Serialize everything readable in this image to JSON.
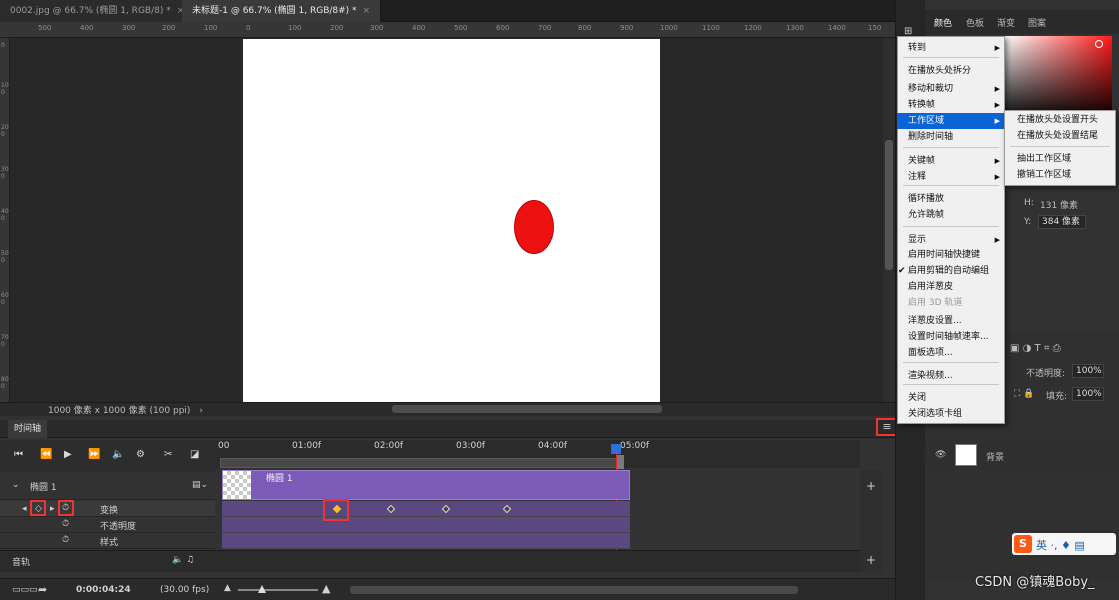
{
  "tabs": [
    {
      "label": "0002.jpg @ 66.7% (椭圆 1, RGB/8) *",
      "close": "×"
    },
    {
      "label": "未标题-1 @ 66.7% (椭圆 1, RGB/8#) *",
      "close": "×"
    }
  ],
  "ruler_top": [
    "500",
    "400",
    "300",
    "200",
    "100",
    "0",
    "100",
    "200",
    "300",
    "400",
    "500",
    "600",
    "700",
    "800",
    "900",
    "1000",
    "1100",
    "1200",
    "1300",
    "1400",
    "150"
  ],
  "ruler_left": [
    "0",
    "100",
    "200",
    "300",
    "400",
    "500",
    "600",
    "700",
    "800"
  ],
  "status": {
    "doc_info": "1000 像素 x 1000 像素 (100 ppi)",
    "arrow": "›"
  },
  "timeline": {
    "tab_label": "时间轴",
    "menu_icon": "≡",
    "time_labels": [
      "00",
      "01:00f",
      "02:00f",
      "03:00f",
      "04:00f",
      "05:00f"
    ],
    "layer_name": "椭圆 1",
    "clip_name": "椭圆 1",
    "properties": [
      "变换",
      "不透明度",
      "样式"
    ],
    "audio_label": "音轨",
    "current_time": "0:00:04:24",
    "fps": "(30.00 fps)",
    "add_label": "+"
  },
  "right_panel": {
    "tabs": [
      "颜色",
      "色板",
      "渐变",
      "图案"
    ],
    "accent_color": "#ff1a1a",
    "h_label": "H:",
    "h_value": "131 像素",
    "y_label": "Y:",
    "y_value": "384 像素",
    "opacity_label": "不透明度:",
    "opacity_value": "100%",
    "fill_label": "填充:",
    "fill_value": "100%",
    "layer_bg": "背景"
  },
  "menu": {
    "items": [
      {
        "label": "转到",
        "submenu": true
      },
      {
        "label": "在播放头处拆分"
      },
      {
        "label": "移动和裁切",
        "submenu": true
      },
      {
        "label": "转换帧",
        "submenu": true
      },
      {
        "label": "工作区域",
        "submenu": true,
        "highlighted": true
      },
      {
        "label": "删除时间轴"
      },
      {
        "label": "关键帧",
        "submenu": true
      },
      {
        "label": "注释",
        "submenu": true
      },
      {
        "label": "循环播放"
      },
      {
        "label": "允许跳帧"
      },
      {
        "label": "显示",
        "submenu": true
      },
      {
        "label": "启用时间轴快捷键"
      },
      {
        "label": "启用剪辑的自动编组",
        "checked": true
      },
      {
        "label": "启用洋葱皮"
      },
      {
        "label": "启用 3D 轨道",
        "disabled": true
      },
      {
        "label": "洋葱皮设置..."
      },
      {
        "label": "设置时间轴帧速率..."
      },
      {
        "label": "面板选项..."
      },
      {
        "label": "渲染视频..."
      },
      {
        "label": "关闭"
      },
      {
        "label": "关闭选项卡组"
      }
    ],
    "submenu_items": [
      "在播放头处设置开头",
      "在播放头处设置结尾",
      "抽出工作区域",
      "撤销工作区域"
    ]
  },
  "ime": {
    "logo": "S",
    "text": "英 ·, ♦ ▤"
  },
  "watermark": "CSDN @镇魂Boby_"
}
